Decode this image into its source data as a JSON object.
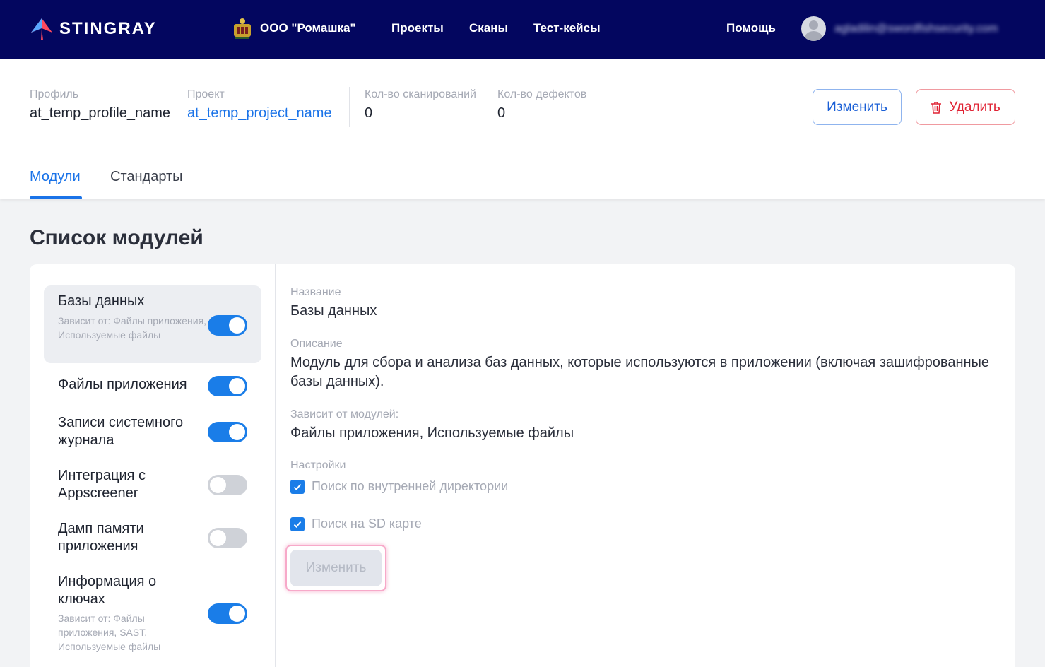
{
  "topbar": {
    "brand": "STINGRAY",
    "org_name": "ООО \"Ромашка\"",
    "nav": [
      "Проекты",
      "Сканы",
      "Тест-кейсы"
    ],
    "help": "Помощь",
    "user_email": "agladilin@swordfishsecurity.com"
  },
  "header": {
    "profile_label": "Профиль",
    "profile_value": "at_temp_profile_name",
    "project_label": "Проект",
    "project_value": "at_temp_project_name",
    "scans_label": "Кол-во сканирований",
    "scans_value": "0",
    "defects_label": "Кол-во дефектов",
    "defects_value": "0",
    "edit_label": "Изменить",
    "delete_label": "Удалить",
    "tabs": [
      {
        "label": "Модули",
        "active": true
      },
      {
        "label": "Стандарты",
        "active": false
      }
    ]
  },
  "section_title": "Список модулей",
  "modules": [
    {
      "title": "Базы данных",
      "deps": "Зависит от:  Файлы приложения, Используемые файлы",
      "enabled": true,
      "selected": true
    },
    {
      "title": "Файлы приложения",
      "deps": "",
      "enabled": true,
      "selected": false
    },
    {
      "title": "Записи системного журнала",
      "deps": "",
      "enabled": true,
      "selected": false
    },
    {
      "title": "Интеграция с Appscreener",
      "deps": "",
      "enabled": false,
      "selected": false
    },
    {
      "title": "Дамп памяти приложения",
      "deps": "",
      "enabled": false,
      "selected": false
    },
    {
      "title": "Информация о ключах",
      "deps": "Зависит от:  Файлы приложения, SAST, Используемые файлы",
      "enabled": true,
      "selected": false
    }
  ],
  "detail": {
    "name_label": "Название",
    "name_value": "Базы данных",
    "desc_label": "Описание",
    "desc_value": "Модуль для сбора и анализа баз данных, которые используются в приложении (включая зашифрованные базы данных).",
    "deps_label": "Зависит от модулей:",
    "deps_value": "Файлы приложения, Используемые файлы",
    "settings_label": "Настройки",
    "settings": [
      {
        "label": "Поиск по внутренней директории",
        "checked": true
      },
      {
        "label": "Поиск на SD карте",
        "checked": true
      }
    ],
    "save_label": "Изменить"
  },
  "colors": {
    "nav_bg": "#03065f",
    "accent": "#1a73e8",
    "danger": "#e02435",
    "toggle_on": "#1a7de8",
    "toggle_off": "#cfd2d8"
  }
}
